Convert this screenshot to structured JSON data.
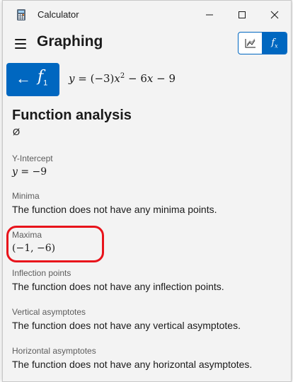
{
  "window": {
    "title": "Calculator"
  },
  "header": {
    "mode": "Graphing"
  },
  "function_row": {
    "label": "f",
    "label_sub": "1",
    "equation": {
      "lhs": "y",
      "expr": " = (−3)",
      "var": "x",
      "power": "2",
      "rest": " − 6",
      "var2": "x",
      "tail": " − 9"
    }
  },
  "analysis": {
    "heading": "Function analysis",
    "domain_symbol": "Ø",
    "sections": [
      {
        "label": "Y-Intercept",
        "value_var": "y",
        "value_rest": " = −9"
      },
      {
        "label": "Minima",
        "value": "The function does not have any minima points."
      },
      {
        "label": "Maxima",
        "value": "(−1, −6)"
      },
      {
        "label": "Inflection points",
        "value": "The function does not have any inflection points."
      },
      {
        "label": "Vertical asymptotes",
        "value": "The function does not have any vertical asymptotes."
      },
      {
        "label": "Horizontal asymptotes",
        "value": "The function does not have any horizontal asymptotes."
      }
    ]
  },
  "colors": {
    "accent": "#0067c0",
    "highlight": "#e8131b"
  },
  "icons": [
    "calculator-icon",
    "minimize-icon",
    "maximize-icon",
    "close-icon",
    "hamburger-icon",
    "graph-icon",
    "function-icon",
    "back-arrow-icon"
  ]
}
